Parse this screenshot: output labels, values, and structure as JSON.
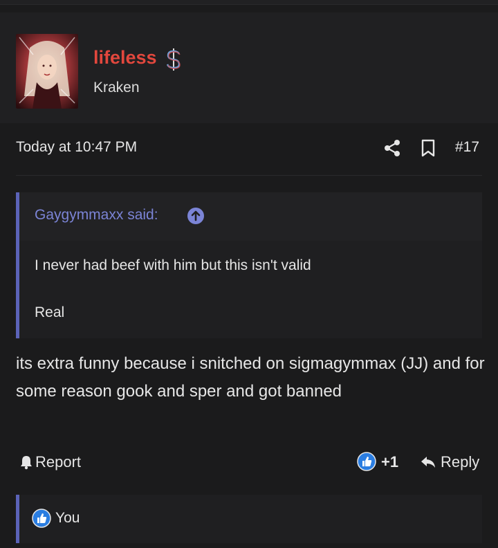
{
  "post": {
    "author": {
      "username": "lifeless",
      "title": "Kraken",
      "username_color": "#e2473d",
      "badge_icon": "dollar-sign-icon"
    },
    "meta": {
      "date": "Today at 10:47 PM",
      "number": "#17",
      "share_icon": "share-icon",
      "bookmark_icon": "bookmark-icon"
    },
    "quote": {
      "author_label": "Gaygymmaxx said:",
      "lines": [
        "I never had beef with him but this isn't valid",
        "Real"
      ],
      "accent_color": "#5b63b8"
    },
    "body": "its extra funny because i snitched on sigmagymmax (JJ) and for some reason gook and sper and got banned",
    "actions": {
      "report_label": "Report",
      "like_count": "+1",
      "reply_label": "Reply"
    },
    "reactions": {
      "users": "You",
      "icon": "thumbs-up-icon"
    }
  }
}
